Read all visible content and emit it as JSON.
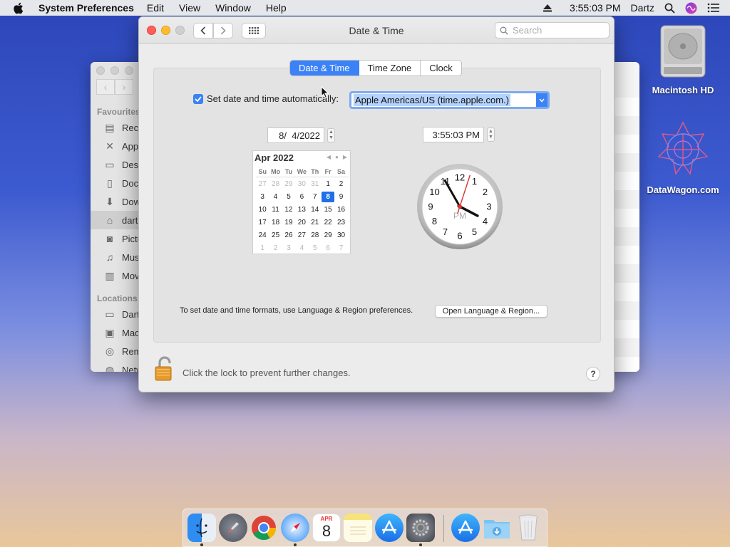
{
  "menubar": {
    "app_name": "System Preferences",
    "items": [
      "Edit",
      "View",
      "Window",
      "Help"
    ],
    "clock": "3:55:03 PM",
    "user": "Dartz"
  },
  "desktop": {
    "icons": [
      {
        "label": "Macintosh HD",
        "icon": "hard-drive-icon"
      },
      {
        "label": "DataWagon.com",
        "icon": "datawagon-logo-icon"
      }
    ]
  },
  "finder": {
    "favourites_heading": "Favourites",
    "favourites": [
      "Rece",
      "App",
      "Desk",
      "Doc",
      "Dow",
      "dart",
      "Pictu",
      "Mus",
      "Mov"
    ],
    "locations_heading": "Locations",
    "locations": [
      "Dart",
      "Mac",
      "Rem",
      "Netw"
    ]
  },
  "prefs": {
    "title": "Date & Time",
    "search_placeholder": "Search",
    "tabs": [
      {
        "label": "Date & Time",
        "active": true
      },
      {
        "label": "Time Zone",
        "active": false
      },
      {
        "label": "Clock",
        "active": false
      }
    ],
    "auto_label": "Set date and time automatically:",
    "auto_checked": true,
    "server": "Apple Americas/US (time.apple.com.)",
    "date_value": "8/  4/2022",
    "time_value": "3:55:03 PM",
    "calendar": {
      "month_label": "Apr 2022",
      "days_of_week": [
        "Su",
        "Mo",
        "Tu",
        "We",
        "Th",
        "Fr",
        "Sa"
      ],
      "weeks": [
        [
          "27",
          "28",
          "29",
          "30",
          "31",
          "1",
          "2"
        ],
        [
          "3",
          "4",
          "5",
          "6",
          "7",
          "8",
          "9"
        ],
        [
          "10",
          "11",
          "12",
          "13",
          "14",
          "15",
          "16"
        ],
        [
          "17",
          "18",
          "19",
          "20",
          "21",
          "22",
          "23"
        ],
        [
          "24",
          "25",
          "26",
          "27",
          "28",
          "29",
          "30"
        ],
        [
          "1",
          "2",
          "3",
          "4",
          "5",
          "6",
          "7"
        ]
      ],
      "selected_day": "8"
    },
    "clock_face": {
      "numbers": [
        "12",
        "1",
        "2",
        "3",
        "4",
        "5",
        "6",
        "7",
        "8",
        "9",
        "10",
        "11"
      ],
      "ampm": "PM",
      "hour": 3,
      "minute": 55,
      "second": 3
    },
    "format_hint": "To set date and time formats, use Language & Region preferences.",
    "open_lr_button": "Open Language & Region...",
    "lock_text": "Click the lock to prevent further changes.",
    "help_label": "?"
  },
  "dock": {
    "apps": [
      "finder-icon",
      "launchpad-icon",
      "chrome-icon",
      "safari-icon",
      "calendar-icon",
      "notes-icon",
      "app-store-icon",
      "system-preferences-icon",
      "app-store-folder-icon",
      "downloads-folder-icon",
      "trash-icon"
    ],
    "calendar_month": "APR",
    "calendar_day": "8"
  }
}
